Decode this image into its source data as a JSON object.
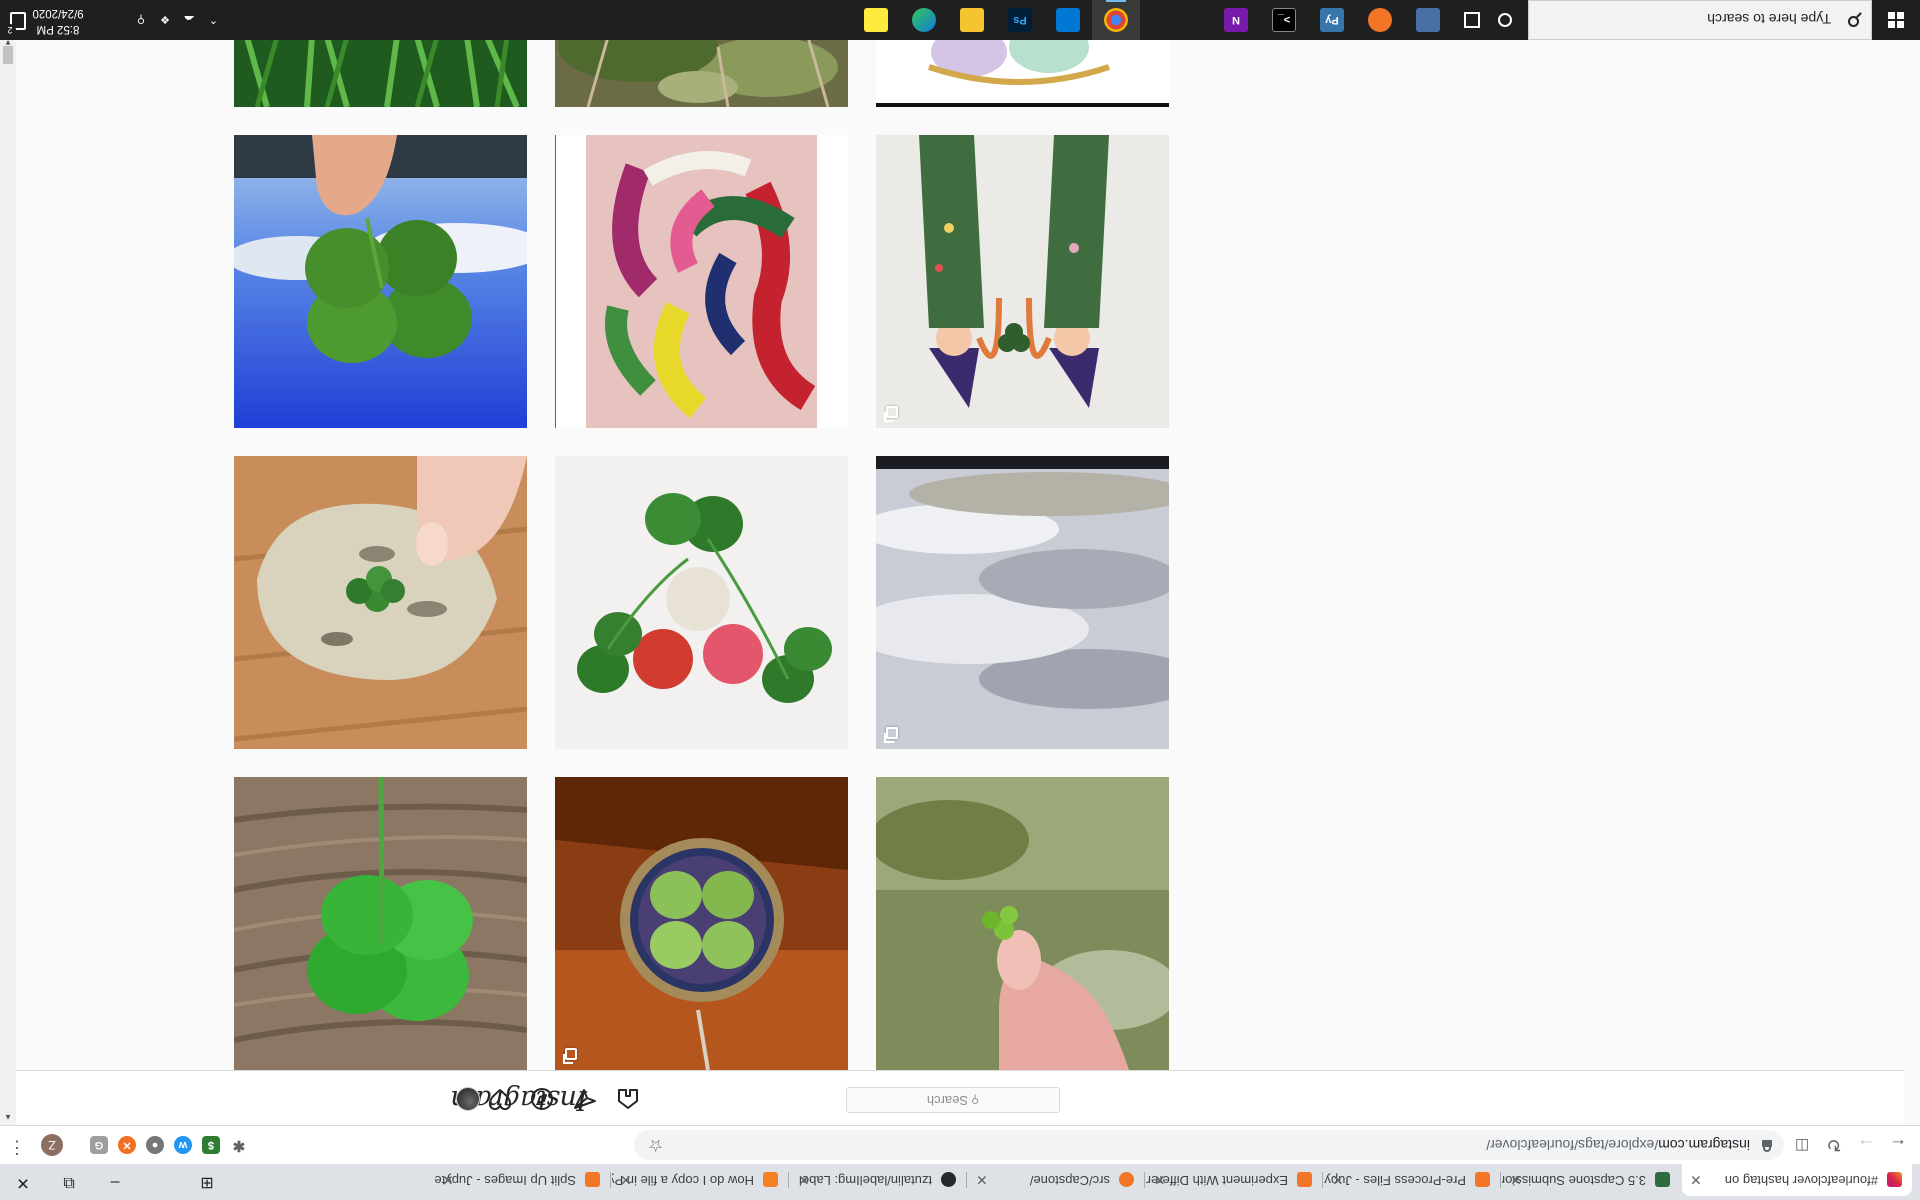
{
  "browser": {
    "tabs": [
      {
        "title": "#fourleafclover hashtag on",
        "favicon_color": "#d6249f",
        "active": true
      },
      {
        "title": "3.5 Capstone Submission - I",
        "favicon_color": "#2e6b3f",
        "active": false
      },
      {
        "title": "Pre-Process Files - Jupyter",
        "favicon_color": "#f37626",
        "active": false
      },
      {
        "title": "Experiment With Different",
        "favicon_color": "#f37626",
        "active": false
      },
      {
        "title": "src/Capstone/",
        "favicon_color": "#f37626",
        "active": false
      },
      {
        "title": "tzutalin/labelImg: Label",
        "favicon_color": "#24292e",
        "active": false
      },
      {
        "title": "How do I copy a file in Pyth",
        "favicon_color": "#f48024",
        "active": false
      },
      {
        "title": "Split Up Images - Jupyter N",
        "favicon_color": "#f37626",
        "active": false
      }
    ],
    "url_host": "instagram.com",
    "url_path": "/explore/tags/fourleafclover/",
    "profile_initial": "Z",
    "extensions": [
      {
        "name": "grammarly-icon",
        "label": "G",
        "color": "#9e9e9e"
      },
      {
        "name": "ext-orange-icon",
        "label": "✕",
        "color": "#f36f21"
      },
      {
        "name": "ext-circle-icon",
        "label": "●",
        "color": "#777777"
      },
      {
        "name": "ext-blue-icon",
        "label": "w",
        "color": "#2196f3"
      },
      {
        "name": "ext-green-icon",
        "label": "$",
        "color": "#2e7d32"
      },
      {
        "name": "extensions-puzzle-icon",
        "label": "✱",
        "color": "#5f6368"
      }
    ]
  },
  "instagram": {
    "logo": "Instagram",
    "search_placeholder": "Search"
  },
  "grid": {
    "posts": [
      {
        "id": "post-blue-sky-clover",
        "multi": false
      },
      {
        "id": "post-abstract-painting",
        "multi": false
      },
      {
        "id": "post-illustration-girls",
        "multi": true
      },
      {
        "id": "post-clover-on-rock",
        "multi": false
      },
      {
        "id": "post-clover-buttons",
        "multi": false
      },
      {
        "id": "post-snow-field",
        "multi": true
      },
      {
        "id": "post-clover-on-wood",
        "multi": false
      },
      {
        "id": "post-clover-pendant",
        "multi": true
      },
      {
        "id": "post-clover-in-hand",
        "multi": false
      }
    ]
  },
  "taskbar": {
    "search_placeholder": "Type here to search",
    "time": "8:52 PM",
    "date": "9/24/2020",
    "notification_count": "2",
    "apps": [
      {
        "name": "file-explorer-icon",
        "color": "#f4c430",
        "label": ""
      },
      {
        "name": "store-icon",
        "color": "#1e6fd9",
        "label": ""
      },
      {
        "name": "chrome-icon",
        "color": "#db4437",
        "label": ""
      },
      {
        "name": "edge-icon",
        "color": "#0f7bd8",
        "label": ""
      },
      {
        "name": "sticky-notes-icon",
        "color": "#ffeb3b",
        "label": ""
      },
      {
        "name": "photoshop-icon",
        "color": "#001e36",
        "label": "Ps"
      },
      {
        "name": "photos-icon",
        "color": "#0078d4",
        "label": ""
      },
      {
        "name": "onenote-icon",
        "color": "#7719aa",
        "label": "N"
      },
      {
        "name": "terminal-icon",
        "color": "#000000",
        "label": ">_"
      },
      {
        "name": "python-icon",
        "color": "#3776ab",
        "label": "Py"
      },
      {
        "name": "jupyter-icon",
        "color": "#f37626",
        "label": ""
      },
      {
        "name": "calculator-icon",
        "color": "#4a6fa5",
        "label": ""
      }
    ]
  }
}
